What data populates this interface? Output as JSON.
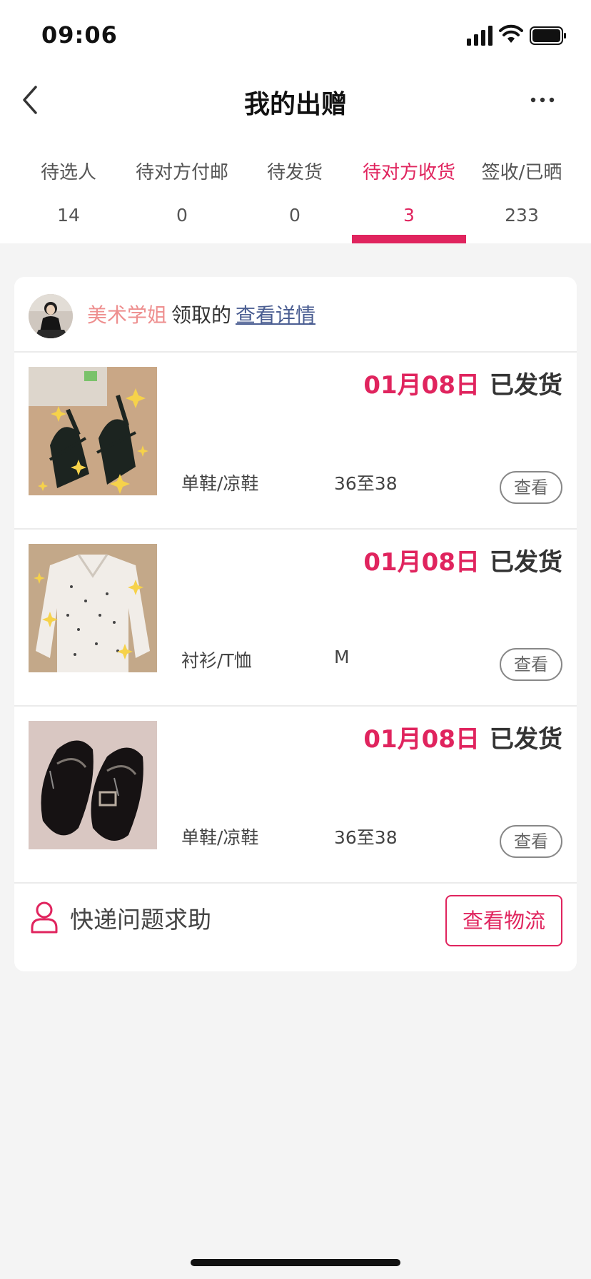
{
  "status_bar": {
    "time": "09:06"
  },
  "nav": {
    "title": "我的出赠"
  },
  "tabs": [
    {
      "label": "待选人",
      "count": "14",
      "active": false
    },
    {
      "label": "待对方付邮",
      "count": "0",
      "active": false
    },
    {
      "label": "待发货",
      "count": "0",
      "active": false
    },
    {
      "label": "待对方收货",
      "count": "3",
      "active": true
    },
    {
      "label": "签收/已晒",
      "count": "233",
      "active": false
    }
  ],
  "card": {
    "taker_name": "美术学姐",
    "taker_verb": "领取的",
    "detail_link": "查看详情",
    "items": [
      {
        "date": "01月08日",
        "status": "已发货",
        "category": "单鞋/凉鞋",
        "size": "36至38",
        "button": "查看",
        "photo": "black-sandals-photo"
      },
      {
        "date": "01月08日",
        "status": "已发货",
        "category": "衬衫/T恤",
        "size": "M",
        "button": "查看",
        "photo": "white-shirt-photo"
      },
      {
        "date": "01月08日",
        "status": "已发货",
        "category": "单鞋/凉鞋",
        "size": "36至38",
        "button": "查看",
        "photo": "black-loafers-photo"
      }
    ],
    "help_label": "快递问题求助",
    "track_button": "查看物流"
  },
  "colors": {
    "accent": "#e0245e",
    "name": "#ee8f8f",
    "link": "#4b5e92",
    "background": "#f4f4f4"
  },
  "icons": [
    "back-chevron-icon",
    "more-dots-icon",
    "person-icon",
    "signal-icon",
    "wifi-icon",
    "battery-icon"
  ]
}
